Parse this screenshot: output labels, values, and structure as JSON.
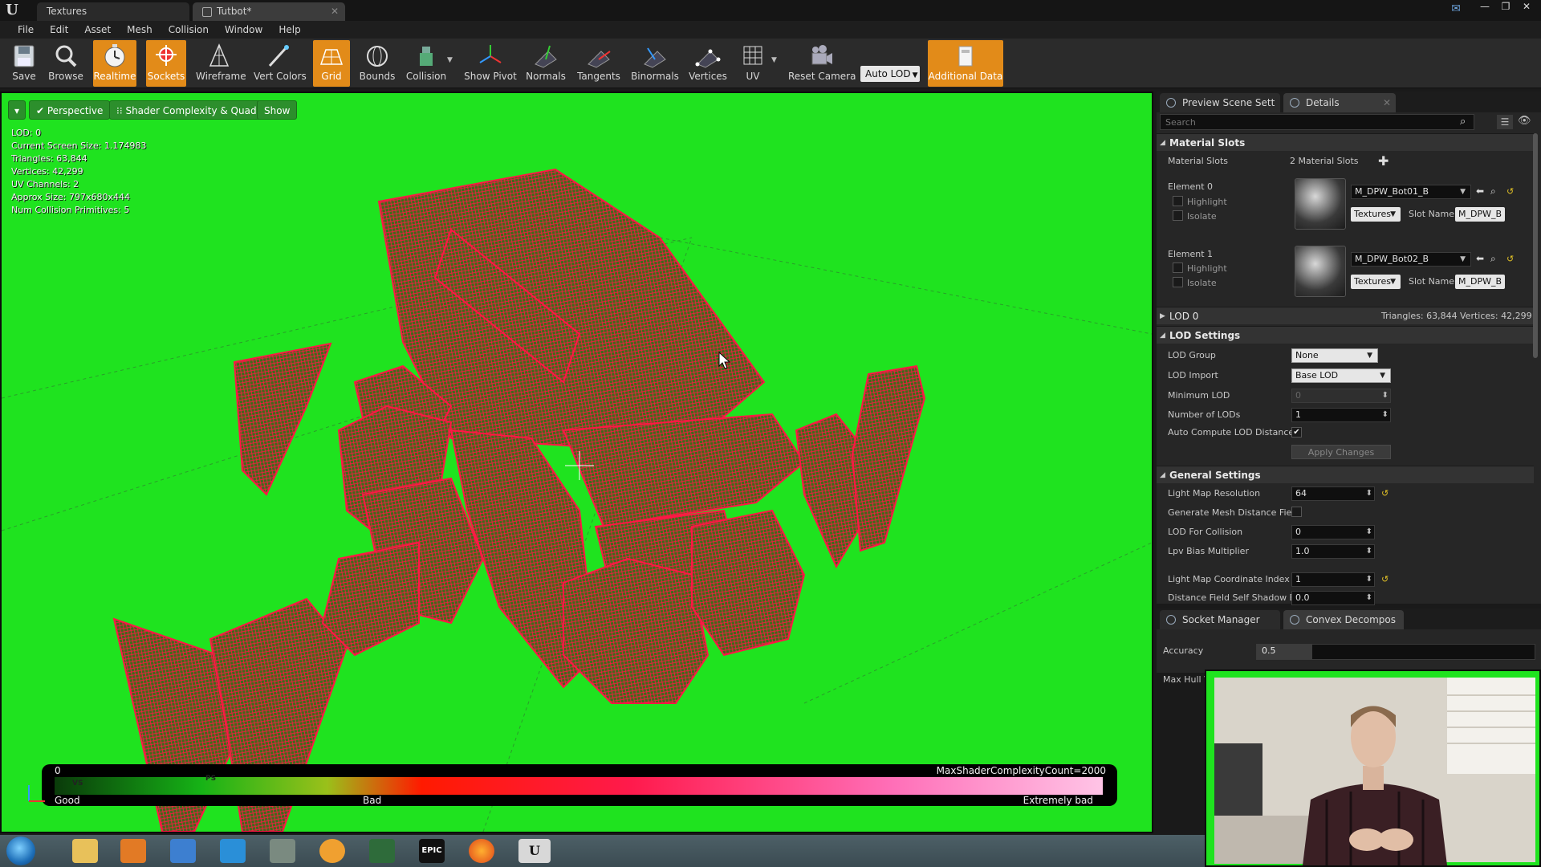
{
  "titlebar": {
    "tabs": [
      {
        "label": "Textures"
      },
      {
        "label": "Tutbot*"
      }
    ],
    "logo": "U",
    "window_controls": {
      "minimize": "—",
      "restore": "❐",
      "close": "✕"
    }
  },
  "menu": [
    "File",
    "Edit",
    "Asset",
    "Mesh",
    "Collision",
    "Window",
    "Help"
  ],
  "toolbar": {
    "buttons": [
      {
        "label": "Save",
        "icon": "save-icon",
        "active": false
      },
      {
        "label": "Browse",
        "icon": "browse-icon",
        "active": false
      },
      {
        "label": "Realtime",
        "icon": "realtime-icon",
        "active": true
      },
      {
        "label": "Sockets",
        "icon": "sockets-icon",
        "active": true
      },
      {
        "label": "Wireframe",
        "icon": "wireframe-icon",
        "active": false
      },
      {
        "label": "Vert Colors",
        "icon": "vert-colors-icon",
        "active": false
      },
      {
        "label": "Grid",
        "icon": "grid-icon",
        "active": true
      },
      {
        "label": "Bounds",
        "icon": "bounds-icon",
        "active": false
      },
      {
        "label": "Collision",
        "icon": "collision-icon",
        "active": false
      },
      {
        "label": "Show Pivot",
        "icon": "pivot-icon",
        "active": false
      },
      {
        "label": "Normals",
        "icon": "normals-icon",
        "active": false
      },
      {
        "label": "Tangents",
        "icon": "tangents-icon",
        "active": false
      },
      {
        "label": "Binormals",
        "icon": "binormals-icon",
        "active": false
      },
      {
        "label": "Vertices",
        "icon": "vertices-icon",
        "active": false
      },
      {
        "label": "UV",
        "icon": "uv-icon",
        "active": false
      },
      {
        "label": "Reset Camera",
        "icon": "camera-icon",
        "active": false
      },
      {
        "label": "Additional Data",
        "icon": "additional-data-icon",
        "active": true
      }
    ],
    "auto_lod": "Auto LOD"
  },
  "viewport": {
    "perspective": "Perspective",
    "view_mode": "Shader Complexity & Quads",
    "show": "Show",
    "stats": [
      "LOD:  0",
      "Current Screen Size:  1.174983",
      "Triangles:  63,844",
      "Vertices:  42,299",
      "UV Channels:  2",
      "Approx Size: 797x680x444",
      "Num Collision Primitives:  5"
    ],
    "legend": {
      "min": "0",
      "max": "MaxShaderComplexityCount=2000",
      "good": "Good",
      "bad": "Bad",
      "extremely_bad": "Extremely bad",
      "vs": "VS",
      "ps": "PS"
    }
  },
  "details": {
    "tabs": [
      {
        "label": "Preview Scene Sett"
      },
      {
        "label": "Details"
      }
    ],
    "search_placeholder": "Search",
    "material_slots": {
      "header": "Material Slots",
      "label": "Material Slots",
      "count": "2 Material Slots",
      "elements": [
        {
          "label": "Element 0",
          "highlight": "Highlight",
          "isolate": "Isolate",
          "material": "M_DPW_Bot01_B",
          "textures": "Textures",
          "slot_name_label": "Slot Name",
          "slot_name": "M_DPW_B"
        },
        {
          "label": "Element 1",
          "highlight": "Highlight",
          "isolate": "Isolate",
          "material": "M_DPW_Bot02_B",
          "textures": "Textures",
          "slot_name_label": "Slot Name",
          "slot_name": "M_DPW_B"
        }
      ]
    },
    "lod0": {
      "header": "LOD 0",
      "triangles": "Triangles: 63,844",
      "vertices": "Vertices: 42,299"
    },
    "lod_settings": {
      "header": "LOD Settings",
      "lod_group_label": "LOD Group",
      "lod_group": "None",
      "lod_import_label": "LOD Import",
      "lod_import": "Base LOD",
      "minimum_lod_label": "Minimum LOD",
      "minimum_lod": "0",
      "number_of_lods_label": "Number of LODs",
      "number_of_lods": "1",
      "auto_compute_label": "Auto Compute LOD Distance",
      "auto_compute": true,
      "apply_changes": "Apply Changes"
    },
    "general_settings": {
      "header": "General Settings",
      "light_map_resolution_label": "Light Map Resolution",
      "light_map_resolution": "64",
      "gen_mesh_df_label": "Generate Mesh Distance Fiel",
      "lod_for_collision_label": "LOD For Collision",
      "lod_for_collision": "0",
      "lpv_bias_label": "Lpv Bias Multiplier",
      "lpv_bias": "1.0",
      "light_map_coord_label": "Light Map Coordinate Index",
      "light_map_coord": "1",
      "df_self_shadow_label": "Distance Field Self Shadow E",
      "df_self_shadow": "0.0"
    }
  },
  "bottom_panel": {
    "tabs": [
      {
        "label": "Socket Manager"
      },
      {
        "label": "Convex Decompos"
      }
    ],
    "accuracy_label": "Accuracy",
    "accuracy_value": "0.5",
    "accuracy_fraction": 0.5,
    "max_hull_label": "Max Hull V"
  },
  "colors": {
    "viewport_bg": "#1fe31f",
    "wireframe": "#ff1744",
    "accent_active": "#e28b19"
  }
}
